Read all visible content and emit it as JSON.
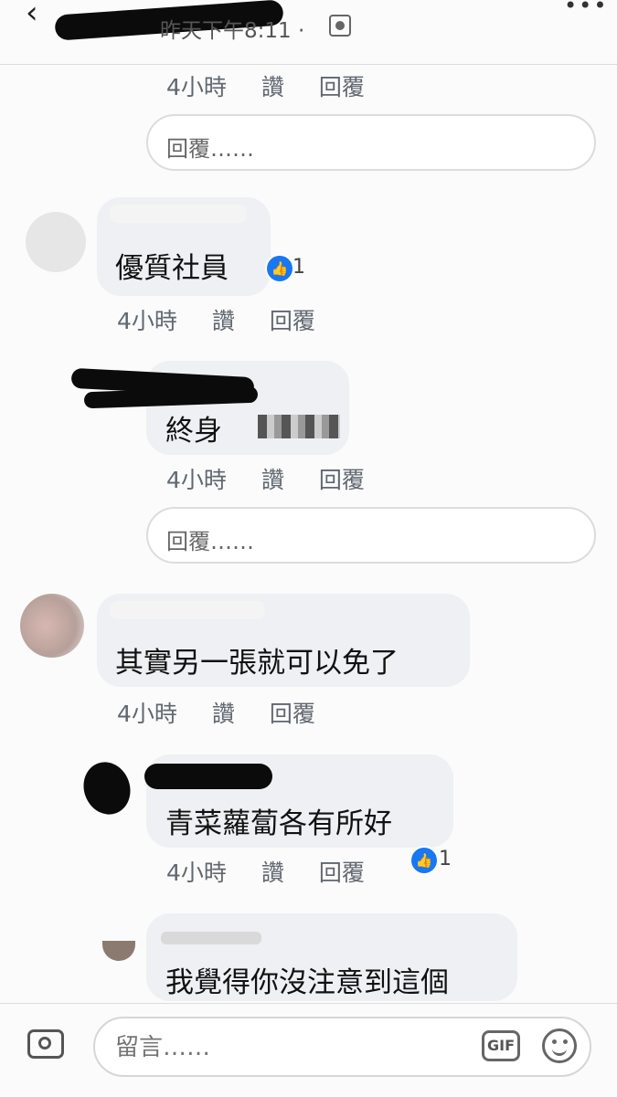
{
  "header": {
    "back_icon": "chevron-left-icon",
    "timestamp": "昨天下午8:11 ·",
    "privacy_icon": "group-icon",
    "more": "•••"
  },
  "actions": {
    "time": "4小時",
    "like": "讚",
    "reply": "回覆"
  },
  "reply_placeholder": "回覆……",
  "comments": [
    {
      "text": "優質社員",
      "likes": "1"
    },
    {
      "text": "終身",
      "likes": ""
    },
    {
      "text": "其實另一張就可以免了",
      "likes": ""
    },
    {
      "text": "青菜蘿蔔各有所好",
      "likes": "1"
    },
    {
      "text": "我覺得你沒注意到這個",
      "likes": ""
    }
  ],
  "composer": {
    "placeholder": "留言……",
    "gif_label": "GIF",
    "camera_icon": "camera-icon",
    "emoji_icon": "smiley-icon"
  },
  "colors": {
    "like_blue": "#1877f2",
    "bubble": "#eef0f3"
  }
}
